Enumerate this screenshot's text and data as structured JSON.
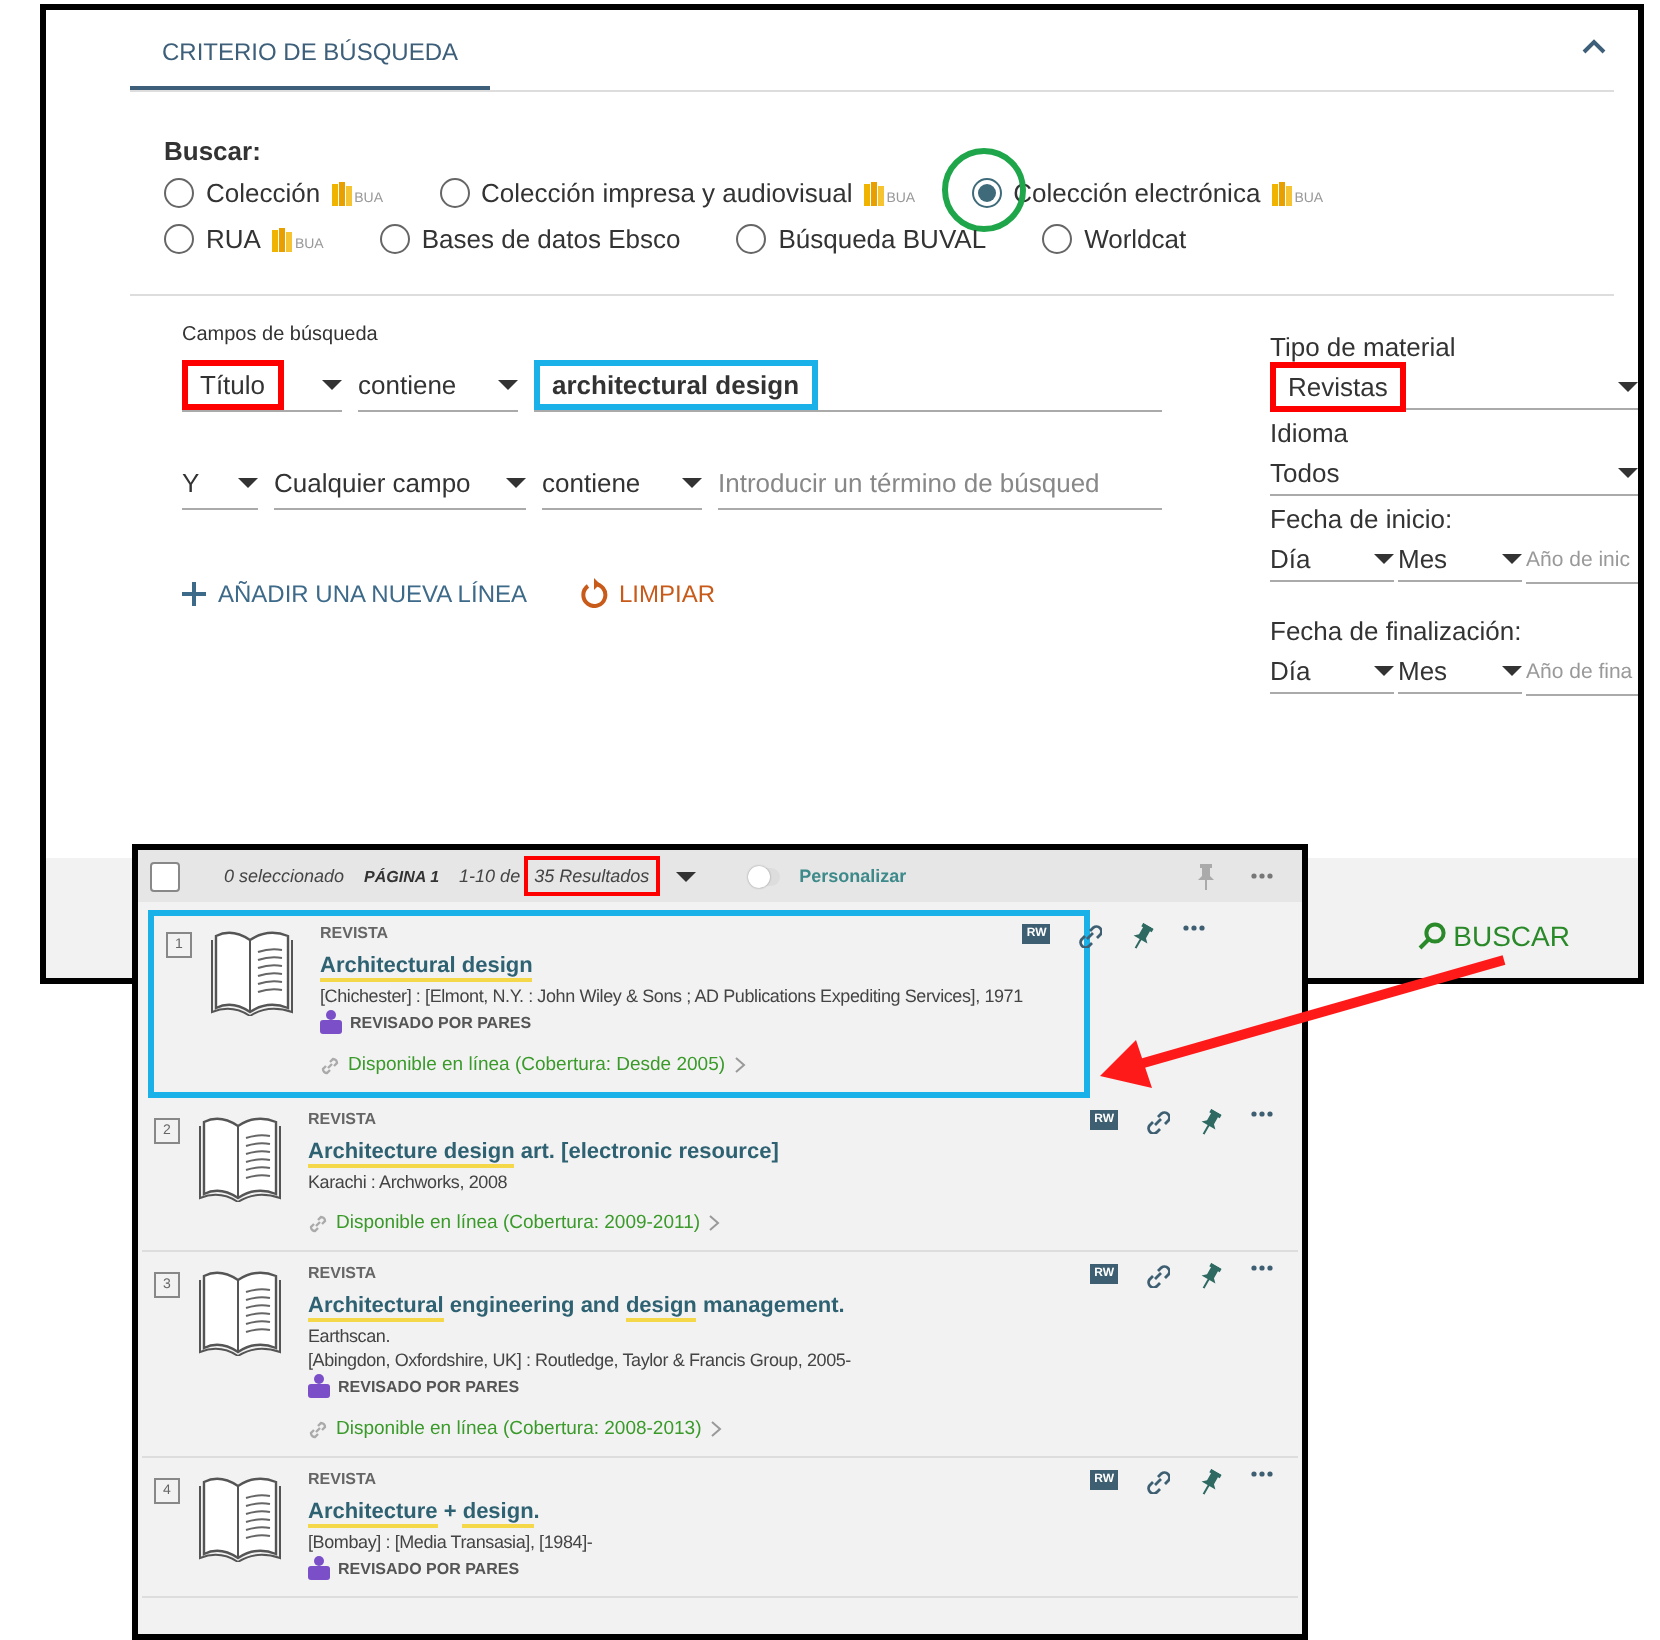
{
  "search_panel": {
    "tab": "CRITERIO DE BÚSQUEDA",
    "search_label": "Buscar:",
    "scopes": [
      {
        "label": "Colección",
        "badge": "BUA",
        "selected": false
      },
      {
        "label": "Colección impresa y audiovisual",
        "badge": "BUA",
        "selected": false
      },
      {
        "label": "Colección electrónica",
        "badge": "BUA",
        "selected": true,
        "annotation": {
          "color": "#1fa64a"
        }
      },
      {
        "label": "RUA",
        "badge": "BUA",
        "selected": false
      },
      {
        "label": "Bases de datos Ebsco",
        "selected": false
      },
      {
        "label": "Búsqueda BUVAL",
        "selected": false
      },
      {
        "label": "Worldcat",
        "selected": false
      }
    ],
    "fields_label": "Campos de búsqueda",
    "rows": [
      {
        "field": "Título",
        "field_annotation": {
          "color": "#ff0000"
        },
        "condition": "contiene",
        "value": "architectural design",
        "value_annotation": {
          "color": "#1ab0e8"
        }
      },
      {
        "operator": "Y",
        "field": "Cualquier campo",
        "condition": "contiene",
        "placeholder": "Introducir un término de búsqued"
      }
    ],
    "add_line": "AÑADIR UNA NUEVA LÍNEA",
    "clear": "LIMPIAR",
    "material_type": {
      "label": "Tipo de material",
      "value": "Revistas",
      "annotation": {
        "color": "#ff0000"
      }
    },
    "language": {
      "label": "Idioma",
      "value": "Todos"
    },
    "start_date": {
      "label": "Fecha de inicio:",
      "day": "Día",
      "month": "Mes",
      "year_placeholder": "Año de inic"
    },
    "end_date": {
      "label": "Fecha de finalización:",
      "day": "Día",
      "month": "Mes",
      "year_placeholder": "Año de fina"
    },
    "search_button": "BUSCAR"
  },
  "results": {
    "select_all_checked": false,
    "selected_count": "0 seleccionado",
    "page": "PÁGINA 1",
    "range": "1-10 de",
    "count": "35 Resultados",
    "count_annotation": {
      "color": "#ff0000"
    },
    "personalize": "Personalizar",
    "personalize_on": false,
    "items": [
      {
        "number": "1",
        "type": "REVISTA",
        "title": [
          {
            "text": "Architectural design",
            "highlighted": true
          }
        ],
        "details": [
          "[Chichester] : [Elmont, N.Y. : John Wiley & Sons ; AD Publications Expediting Services], 1971"
        ],
        "peer_reviewed": "REVISADO POR PARES",
        "availability": "Disponible en línea (Cobertura: Desde 2005)",
        "badge": "RW",
        "annotation": {
          "color": "#1ab0e8"
        }
      },
      {
        "number": "2",
        "type": "REVISTA",
        "title": [
          {
            "text": "Architecture design",
            "highlighted": true
          },
          {
            "text": " art. [electronic resource]",
            "highlighted": false
          }
        ],
        "details": [
          "Karachi : Archworks, 2008"
        ],
        "availability": "Disponible en línea (Cobertura: 2009-2011)",
        "badge": "RW"
      },
      {
        "number": "3",
        "type": "REVISTA",
        "title": [
          {
            "text": "Architectural",
            "highlighted": true
          },
          {
            "text": " engineering and ",
            "highlighted": false
          },
          {
            "text": "design",
            "highlighted": true
          },
          {
            "text": " management.",
            "highlighted": false
          }
        ],
        "details": [
          "Earthscan.",
          "[Abingdon, Oxfordshire, UK] : Routledge, Taylor & Francis Group, 2005-"
        ],
        "peer_reviewed": "REVISADO POR PARES",
        "availability": "Disponible en línea (Cobertura: 2008-2013)",
        "badge": "RW"
      },
      {
        "number": "4",
        "type": "REVISTA",
        "title": [
          {
            "text": "Architecture",
            "highlighted": true
          },
          {
            "text": " + ",
            "highlighted": false
          },
          {
            "text": "design",
            "highlighted": true
          },
          {
            "text": ".",
            "highlighted": false
          }
        ],
        "details": [
          "[Bombay] : [Media Transasia], [1984]-"
        ],
        "peer_reviewed": "REVISADO POR PARES",
        "badge": "RW"
      }
    ]
  }
}
